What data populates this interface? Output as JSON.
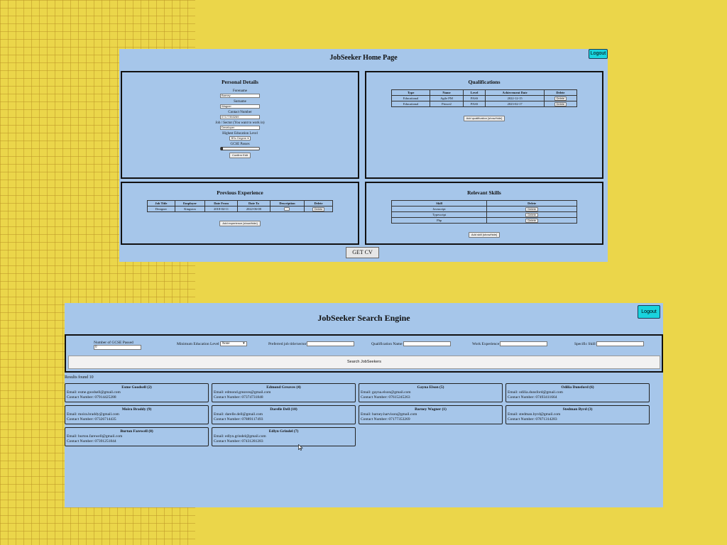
{
  "home": {
    "title": "JobSeeker Home Page",
    "logout": "Logout",
    "personal": {
      "title": "Personal Details",
      "forename_label": "Forename",
      "forename": "Barney",
      "surname_label": "Surname",
      "surname": "Wagner",
      "contact_label": "Contact Number",
      "contact": "07177353269",
      "sector_label": "Job / Sector (You want to work in)",
      "sector": "Developer",
      "education_label": "Highest Education Level",
      "education": "BSc Degree",
      "gcse_label": "GCSE Passes",
      "gcse_value": 0,
      "confirm": "Confirm Edit"
    },
    "qualifications": {
      "title": "Qualifications",
      "headers": [
        "Type",
        "Name",
        "Level",
        "Achievement Date",
        "Delete"
      ],
      "rows": [
        [
          "Educational",
          "Agile PM",
          "PASS",
          "2022-12-15",
          "Delete"
        ],
        [
          "Educational",
          "Prince2",
          "PASS",
          "2023-02-17",
          "Delete"
        ]
      ],
      "add": "Add qualification [show/hide]"
    },
    "experience": {
      "title": "Previous Experience",
      "headers": [
        "Job Title",
        "Employer",
        "Date From",
        "Date To",
        "Description",
        "Delete"
      ],
      "rows": [
        [
          "Designer",
          "Kingston",
          "2018-04-11",
          "2022-06-08",
          "",
          "Delete"
        ]
      ],
      "add": "Add experience [show/hide]"
    },
    "skills": {
      "title": "Relevant Skills",
      "headers": [
        "Skill",
        "Delete"
      ],
      "rows": [
        [
          "Javascript",
          "Delete"
        ],
        [
          "Typescript",
          "Delete"
        ],
        [
          "Php",
          "Delete"
        ]
      ],
      "add": "Add skill [show/hide]"
    },
    "get_cv": "GET CV"
  },
  "search": {
    "title": "JobSeeker Search Engine",
    "logout": "Logout",
    "filters": {
      "gcse_label": "Number of GCSE Passed",
      "gcse_value": "0",
      "education_label": "Minimum Education Level",
      "education_value": "None",
      "job_label": "Preferred job title/sector",
      "qualification_label": "Qualification Name",
      "experience_label": "Work Experience",
      "skill_label": "Specific Skill"
    },
    "search_button": "Search JobSeekers",
    "results_label": "Results found 10",
    "results": [
      {
        "name": "Esme Goodsell (2)",
        "email": "Email: esme.goodsell@gmail.com",
        "phone": "Contact Number: 07914425288"
      },
      {
        "name": "Edmond Greaves (4)",
        "email": "Email: edmond.greaves@gmail.com",
        "phone": "Contact Number: 07374731848"
      },
      {
        "name": "Gayna Elson (5)",
        "email": "Email: gayna.elson@gmail.com",
        "phone": "Contact Number: 07615245263"
      },
      {
        "name": "Odilia Dunsford (6)",
        "email": "Email: odilia.dunsford@gmail.com",
        "phone": "Contact Number: 07493411664"
      },
      {
        "name": "Moira Braddy (9)",
        "email": "Email: moira.braddy@gmail.com",
        "phone": "Contact Number: 07326714435"
      },
      {
        "name": "Darelle Dell (10)",
        "email": "Email: darelle.dell@gmail.com",
        "phone": "Contact Number: 07889117493"
      },
      {
        "name": "Barney Wagner (1)",
        "email": "Email: barney.harvison@gmail.com",
        "phone": "Contact Number: 07177353269"
      },
      {
        "name": "Stedman Byrd (3)",
        "email": "Email: stedman.byrd@gmail.com",
        "phone": "Contact Number: 07871314283"
      },
      {
        "name": "Burton Farewell (8)",
        "email": "Email: burton.farewell@gmail.com",
        "phone": "Contact Number: 07391251844"
      },
      {
        "name": "Edlyn Grindel (7)",
        "email": "Email: edlyn.grindel@gmail.com",
        "phone": "Contact Number: 07431281283"
      }
    ]
  }
}
